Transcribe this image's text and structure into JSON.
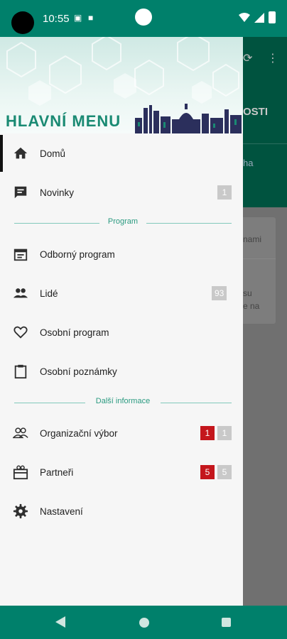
{
  "status_bar": {
    "time": "10:55"
  },
  "header": {
    "title": "HLAVNÍ MENU"
  },
  "background": {
    "title_fragment": "OSTI",
    "tab_fragment": "ha",
    "card_text_1": "nami",
    "card_text_2": "su",
    "card_text_3": "e na"
  },
  "menu": {
    "home": {
      "label": "Domů"
    },
    "news": {
      "label": "Novinky",
      "badge": "1"
    },
    "section_program": "Program",
    "program": {
      "label": "Odborný program"
    },
    "people": {
      "label": "Lidé",
      "badge": "93"
    },
    "personal_program": {
      "label": "Osobní program"
    },
    "personal_notes": {
      "label": "Osobní poznámky"
    },
    "section_info": "Další informace",
    "committee": {
      "label": "Organizační výbor",
      "badge_red": "1",
      "badge_gray": "1"
    },
    "partners": {
      "label": "Partneři",
      "badge_red": "5",
      "badge_gray": "5"
    },
    "settings": {
      "label": "Nastavení"
    }
  },
  "icons": {
    "home": "home-icon",
    "news": "chat-icon",
    "program": "calendar-icon",
    "people": "people-icon",
    "personal_program": "heart-icon",
    "personal_notes": "clipboard-icon",
    "committee": "group-icon",
    "partners": "partners-icon",
    "settings": "gear-icon"
  },
  "colors": {
    "accent": "#00806b",
    "header_text": "#1a8a73",
    "badge_red": "#c4161c",
    "badge_gray": "#c9c9c9"
  }
}
